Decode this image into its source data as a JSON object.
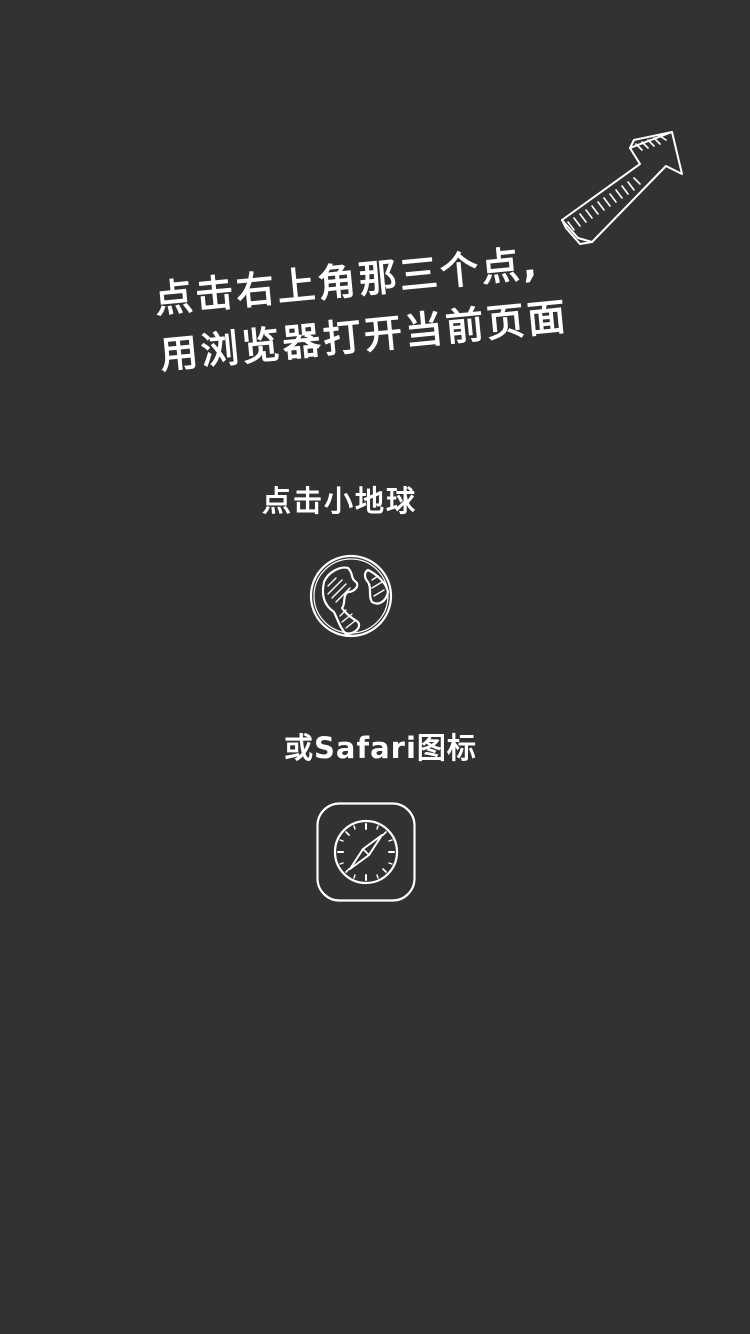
{
  "instructions": {
    "headline_line1": "点击右上角那三个点,",
    "headline_line2": "用浏览器打开当前页面",
    "tap_globe_label": "点击小地球",
    "tap_safari_label": "或Safari图标"
  },
  "icons": {
    "arrow": "arrow-up-right-icon",
    "globe": "globe-icon",
    "safari": "safari-compass-icon"
  },
  "colors": {
    "background": "#323232",
    "foreground": "#ffffff"
  }
}
